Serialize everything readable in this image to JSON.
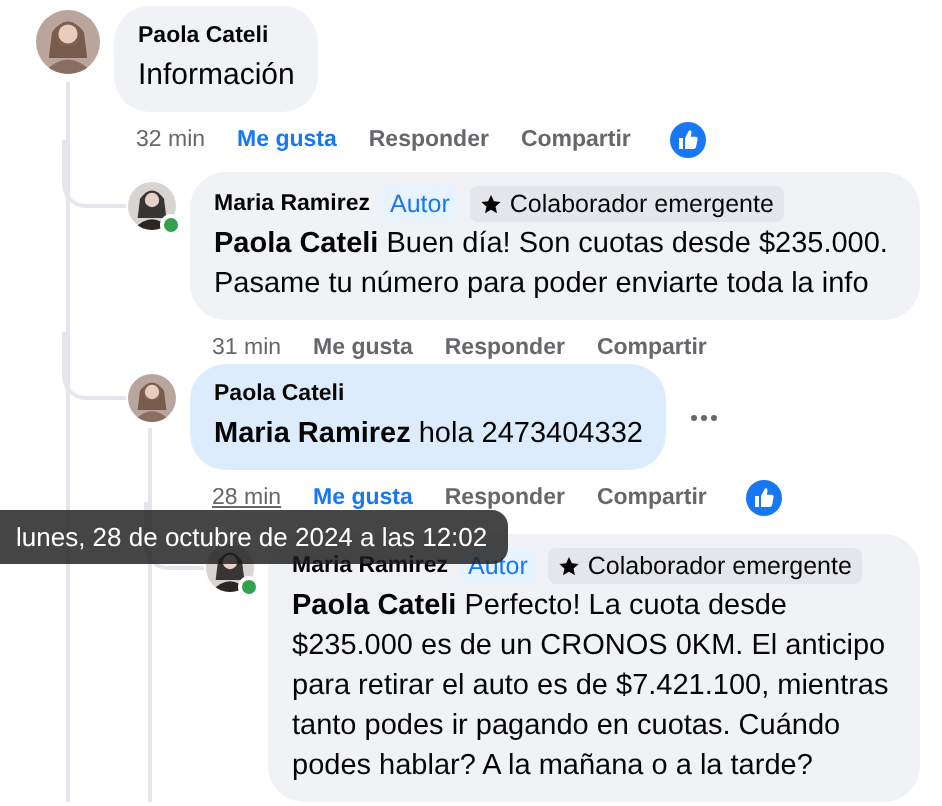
{
  "comments": [
    {
      "author": "Paola Cateli",
      "text": "Información",
      "time": "32 min",
      "time_hovered": false,
      "like_label": "Me gusta",
      "liked": true,
      "reply_label": "Responder",
      "share_label": "Compartir",
      "has_reaction": true,
      "replies": [
        {
          "author": "Maria Ramirez",
          "badges": [
            {
              "kind": "author",
              "label": "Autor"
            },
            {
              "kind": "contributor",
              "label": "Colaborador emergente"
            }
          ],
          "text": "**Paola Cateli** Buen día! Son cuotas desde $235.000. Pasame tu número para poder enviarte toda la info",
          "time": "31 min",
          "time_hovered": false,
          "like_label": "Me gusta",
          "liked": false,
          "reply_label": "Responder",
          "share_label": "Compartir",
          "highlighted": false,
          "online": true
        },
        {
          "author": "Paola Cateli",
          "text": "**Maria Ramirez** hola 2473404332",
          "time": "28 min",
          "time_hovered": true,
          "like_label": "Me gusta",
          "liked": true,
          "reply_label": "Responder",
          "share_label": "Compartir",
          "has_reaction": true,
          "highlighted": true,
          "more_button": true,
          "replies": [
            {
              "author": "Maria Ramirez",
              "badges": [
                {
                  "kind": "author",
                  "label": "Autor"
                },
                {
                  "kind": "contributor",
                  "label": "Colaborador emergente"
                }
              ],
              "text": "**Paola Cateli** Perfecto! La cuota desde $235.000 es de un CRONOS 0KM. El anticipo para retirar el auto es de $7.421.100, mientras tanto podes ir pagando en cuotas. Cuándo podes hablar? A la mañana o a la tarde?",
              "highlighted": false,
              "online": true
            }
          ]
        }
      ]
    }
  ],
  "tooltip": {
    "text": "lunes, 28 de octubre de 2024 a las 12:02"
  }
}
